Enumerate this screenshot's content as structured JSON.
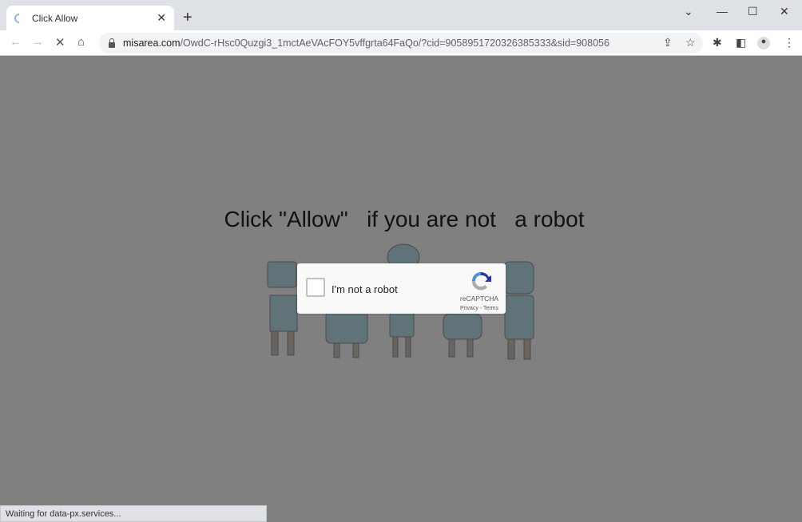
{
  "browser": {
    "tab_title": "Click Allow",
    "url_domain": "misarea.com",
    "url_path": "/OwdC-rHsc0Quzgi3_1mctAeVAcFOY5vffgrta64FaQo/?cid=9058951720326385333&sid=908056",
    "status_text": "Waiting for data-px.services..."
  },
  "page": {
    "headline": "Click \"Allow\"   if you are not   a robot",
    "captcha": {
      "label": "I'm not a robot",
      "brand": "reCAPTCHA",
      "links": "Privacy - Terms"
    }
  }
}
